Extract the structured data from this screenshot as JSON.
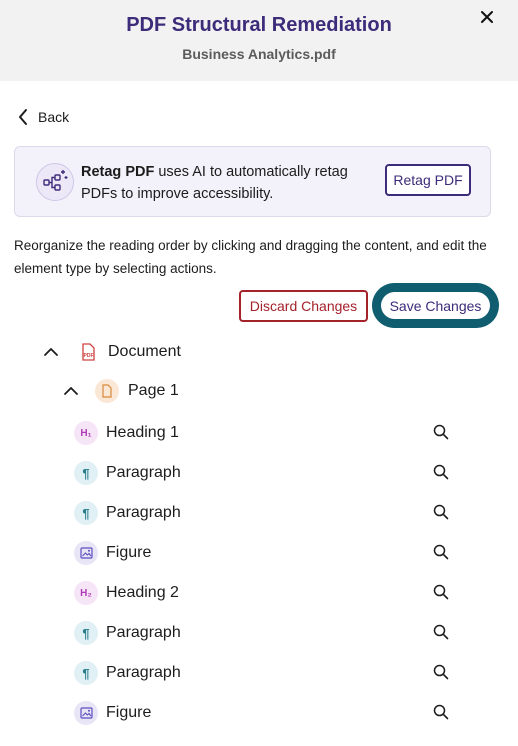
{
  "header": {
    "title": "PDF Structural Remediation",
    "subtitle": "Business Analytics.pdf",
    "close_icon": "close-icon"
  },
  "nav": {
    "back_label": "Back"
  },
  "retag_card": {
    "bold": "Retag PDF",
    "text": " uses AI to automatically retag PDFs to improve accessibility.",
    "button_label": "Retag PDF",
    "icon": "ai-workflow-icon"
  },
  "instructions": "Reorganize the reading order by clicking and dragging the content, and edit the element type by selecting actions.",
  "actions": {
    "discard_label": "Discard Changes",
    "save_label": "Save Changes"
  },
  "colors": {
    "brand": "#3d2c7a",
    "danger": "#a4222a",
    "focus_ring": "#0f5d6f"
  },
  "tree": {
    "root": {
      "label": "Document",
      "icon": "pdf-icon",
      "icon_text": "PDF"
    },
    "page": {
      "label": "Page 1",
      "icon": "page-icon"
    },
    "items": [
      {
        "label": "Heading 1",
        "type": "heading",
        "icon_text": "H₁"
      },
      {
        "label": "Paragraph",
        "type": "paragraph",
        "icon_text": "¶"
      },
      {
        "label": "Paragraph",
        "type": "paragraph",
        "icon_text": "¶"
      },
      {
        "label": "Figure",
        "type": "figure",
        "icon_text": ""
      },
      {
        "label": "Heading 2",
        "type": "heading",
        "icon_text": "H₂"
      },
      {
        "label": "Paragraph",
        "type": "paragraph",
        "icon_text": "¶"
      },
      {
        "label": "Paragraph",
        "type": "paragraph",
        "icon_text": "¶"
      },
      {
        "label": "Figure",
        "type": "figure",
        "icon_text": ""
      }
    ]
  }
}
